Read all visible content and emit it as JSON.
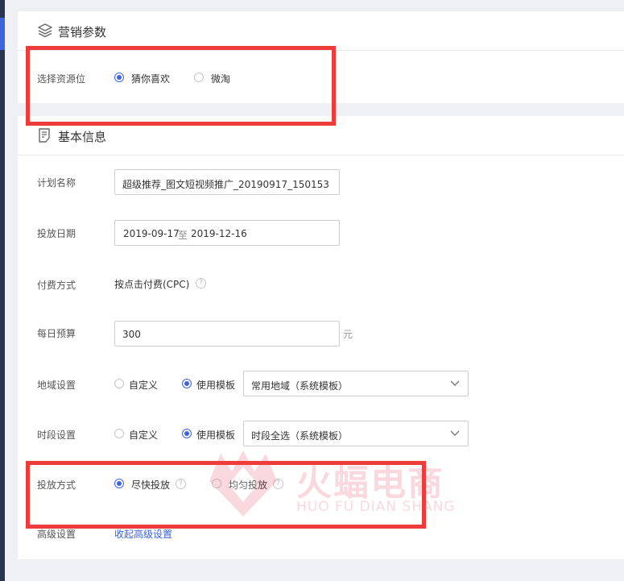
{
  "marketing": {
    "title": "营销参数",
    "resource_label": "选择资源位",
    "resource_options": [
      "猜你喜欢",
      "微淘"
    ]
  },
  "basic": {
    "title": "基本信息",
    "plan_name": {
      "label": "计划名称",
      "value": "超级推荐_图文短视频推广_20190917_150153"
    },
    "date": {
      "label": "投放日期",
      "start": "2019-09-17",
      "sep": "至",
      "end": "2019-12-16"
    },
    "payment": {
      "label": "付费方式",
      "value": "按点击付费(CPC)"
    },
    "budget": {
      "label": "每日预算",
      "value": "300",
      "unit": "元"
    },
    "region": {
      "label": "地域设置",
      "options": [
        "自定义",
        "使用模板"
      ],
      "template": "常用地域（系统模板）"
    },
    "time": {
      "label": "时段设置",
      "options": [
        "自定义",
        "使用模板"
      ],
      "template": "时段全选（系统模板）"
    },
    "delivery": {
      "label": "投放方式",
      "options": [
        "尽快投放",
        "均匀投放"
      ]
    },
    "advanced": {
      "label": "高级设置",
      "link": "收起高级设置"
    }
  },
  "watermark": {
    "cn": "火蝠电商",
    "en": "HUO FU DIAN SHANG"
  },
  "colors": {
    "accent": "#3d63dd",
    "highlight": "#ee3b3b",
    "sidebar": "#2b3353",
    "background": "#eef0f4"
  }
}
